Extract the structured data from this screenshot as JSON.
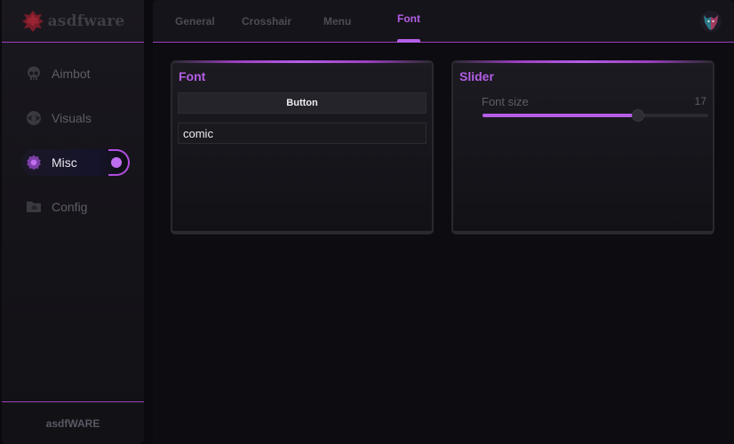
{
  "brand": {
    "name": "asdfware",
    "logo_icon": "red-leaf-logo-icon"
  },
  "sidebar": {
    "items": [
      {
        "label": "Aimbot",
        "icon": "skull-icon",
        "active": false
      },
      {
        "label": "Visuals",
        "icon": "eye-icon",
        "active": false
      },
      {
        "label": "Misc",
        "icon": "gear-icon",
        "active": true
      },
      {
        "label": "Config",
        "icon": "folder-icon",
        "active": false
      }
    ],
    "footer": "asdfWARE"
  },
  "tabs": [
    {
      "label": "General",
      "active": false
    },
    {
      "label": "Crosshair",
      "active": false
    },
    {
      "label": "Menu",
      "active": false
    },
    {
      "label": "Font",
      "active": true
    }
  ],
  "avatar_icon": "wolf-avatar-icon",
  "panels": {
    "font": {
      "title": "Font",
      "button_label": "Button",
      "input_value": "comic"
    },
    "slider": {
      "title": "Slider",
      "label": "Font size",
      "value": "17",
      "fill_fraction": 0.69
    }
  },
  "colors": {
    "accent": "#b45ee6",
    "background": "#0b0a0f",
    "panel": "#1c1b21",
    "muted_text": "#5f5d67",
    "logo_red": "#8a1f2c"
  }
}
